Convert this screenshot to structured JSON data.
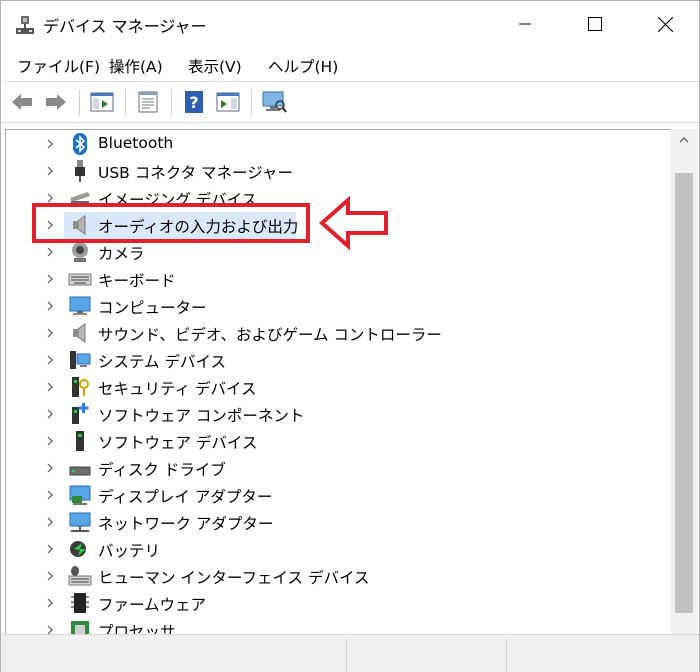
{
  "window": {
    "title": "デバイス マネージャー"
  },
  "menu": {
    "items": [
      "ファイル(F)",
      "操作(A)",
      "表示(V)",
      "ヘルプ(H)"
    ]
  },
  "tree": {
    "items": [
      {
        "label": "Bluetooth",
        "icon": "bluetooth-icon"
      },
      {
        "label": "USB コネクタ マネージャー",
        "icon": "usb-connector-icon"
      },
      {
        "label": "イメージング デバイス",
        "icon": "imaging-device-icon"
      },
      {
        "label": "オーディオの入力および出力",
        "icon": "audio-speaker-icon",
        "selected": true
      },
      {
        "label": "カメラ",
        "icon": "camera-icon"
      },
      {
        "label": "キーボード",
        "icon": "keyboard-icon"
      },
      {
        "label": "コンピューター",
        "icon": "computer-icon"
      },
      {
        "label": "サウンド、ビデオ、およびゲーム コントローラー",
        "icon": "sound-speaker-icon"
      },
      {
        "label": "システム デバイス",
        "icon": "system-device-icon"
      },
      {
        "label": "セキュリティ デバイス",
        "icon": "security-device-icon"
      },
      {
        "label": "ソフトウェア コンポーネント",
        "icon": "software-component-icon"
      },
      {
        "label": "ソフトウェア デバイス",
        "icon": "software-device-icon"
      },
      {
        "label": "ディスク ドライブ",
        "icon": "disk-drive-icon"
      },
      {
        "label": "ディスプレイ アダプター",
        "icon": "display-adapter-icon"
      },
      {
        "label": "ネットワーク アダプター",
        "icon": "network-adapter-icon"
      },
      {
        "label": "バッテリ",
        "icon": "battery-icon"
      },
      {
        "label": "ヒューマン インターフェイス デバイス",
        "icon": "hid-icon"
      },
      {
        "label": "ファームウェア",
        "icon": "firmware-icon"
      },
      {
        "label": "プロセッサ",
        "icon": "processor-icon"
      }
    ]
  },
  "colors": {
    "highlight_box": "#e0202a",
    "selection": "#d9e8fa"
  }
}
